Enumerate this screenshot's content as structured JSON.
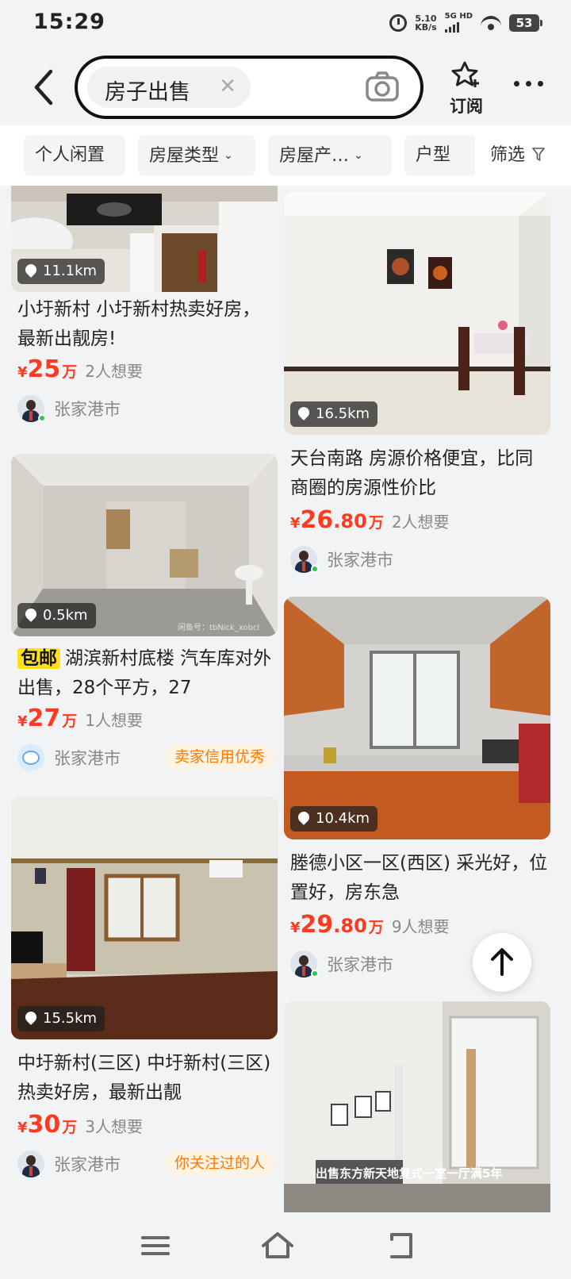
{
  "status_bar": {
    "time": "15:29",
    "net_speed": "5.10",
    "net_speed_unit": "KB/s",
    "network": "5G HD",
    "battery": "53"
  },
  "header": {
    "search_chip": "房子出售",
    "subscribe_label": "订阅"
  },
  "filters": {
    "items": [
      {
        "label": "个人闲置",
        "chevron": false
      },
      {
        "label": "房屋类型",
        "chevron": true
      },
      {
        "label": "房屋产…",
        "chevron": true
      },
      {
        "label": "户型",
        "chevron": false
      }
    ],
    "more_label": "筛选"
  },
  "listings": [
    {
      "distance": "11.1km",
      "title": "小圩新村 小圩新村热卖好房，最新出靓房!",
      "badge": "",
      "price_int": "25",
      "price_dec": "",
      "price_unit": "万",
      "wants": "2人想要",
      "city": "张家港市",
      "tag": "",
      "avatar": "man",
      "online": true
    },
    {
      "distance": "0.5km",
      "title": "湖滨新村底楼 汽车库对外出售，28个平方，27",
      "badge": "包邮",
      "price_int": "27",
      "price_dec": "",
      "price_unit": "万",
      "wants": "1人想要",
      "city": "张家港市",
      "tag": "卖家信用优秀",
      "avatar": "robot",
      "online": false,
      "watermark": "闲鱼号：tbNick_xobcl"
    },
    {
      "distance": "15.5km",
      "title": "中圩新村(三区) 中圩新村(三区)热卖好房，最新出靓",
      "badge": "",
      "price_int": "30",
      "price_dec": "",
      "price_unit": "万",
      "wants": "3人想要",
      "city": "张家港市",
      "tag": "你关注过的人",
      "avatar": "man",
      "online": false
    },
    {
      "distance": "16.5km",
      "title": "天台南路 房源价格便宜，比同商圈的房源性价比",
      "badge": "",
      "price_int": "26",
      "price_dec": ".80",
      "price_unit": "万",
      "wants": "2人想要",
      "city": "张家港市",
      "tag": "",
      "avatar": "man",
      "online": true
    },
    {
      "distance": "10.4km",
      "title": "塍德小区一区(西区) 采光好，位置好，房东急",
      "badge": "",
      "price_int": "29",
      "price_dec": ".80",
      "price_unit": "万",
      "wants": "9人想要",
      "city": "张家港市",
      "tag": "",
      "avatar": "man",
      "online": true
    },
    {
      "distance": "",
      "title": "",
      "badge": "",
      "price_int": "",
      "price_dec": "",
      "price_unit": "",
      "wants": "",
      "city": "",
      "tag": "",
      "avatar": "",
      "online": false,
      "overlay_text": "出售东方新天地复式一室一厅满5年"
    }
  ],
  "colors": {
    "price": "#ff3b1f",
    "tag_text": "#ff7a00",
    "tag_bg": "#fff3e4",
    "badge_bg": "#ffe01a",
    "online": "#2bc84c"
  }
}
